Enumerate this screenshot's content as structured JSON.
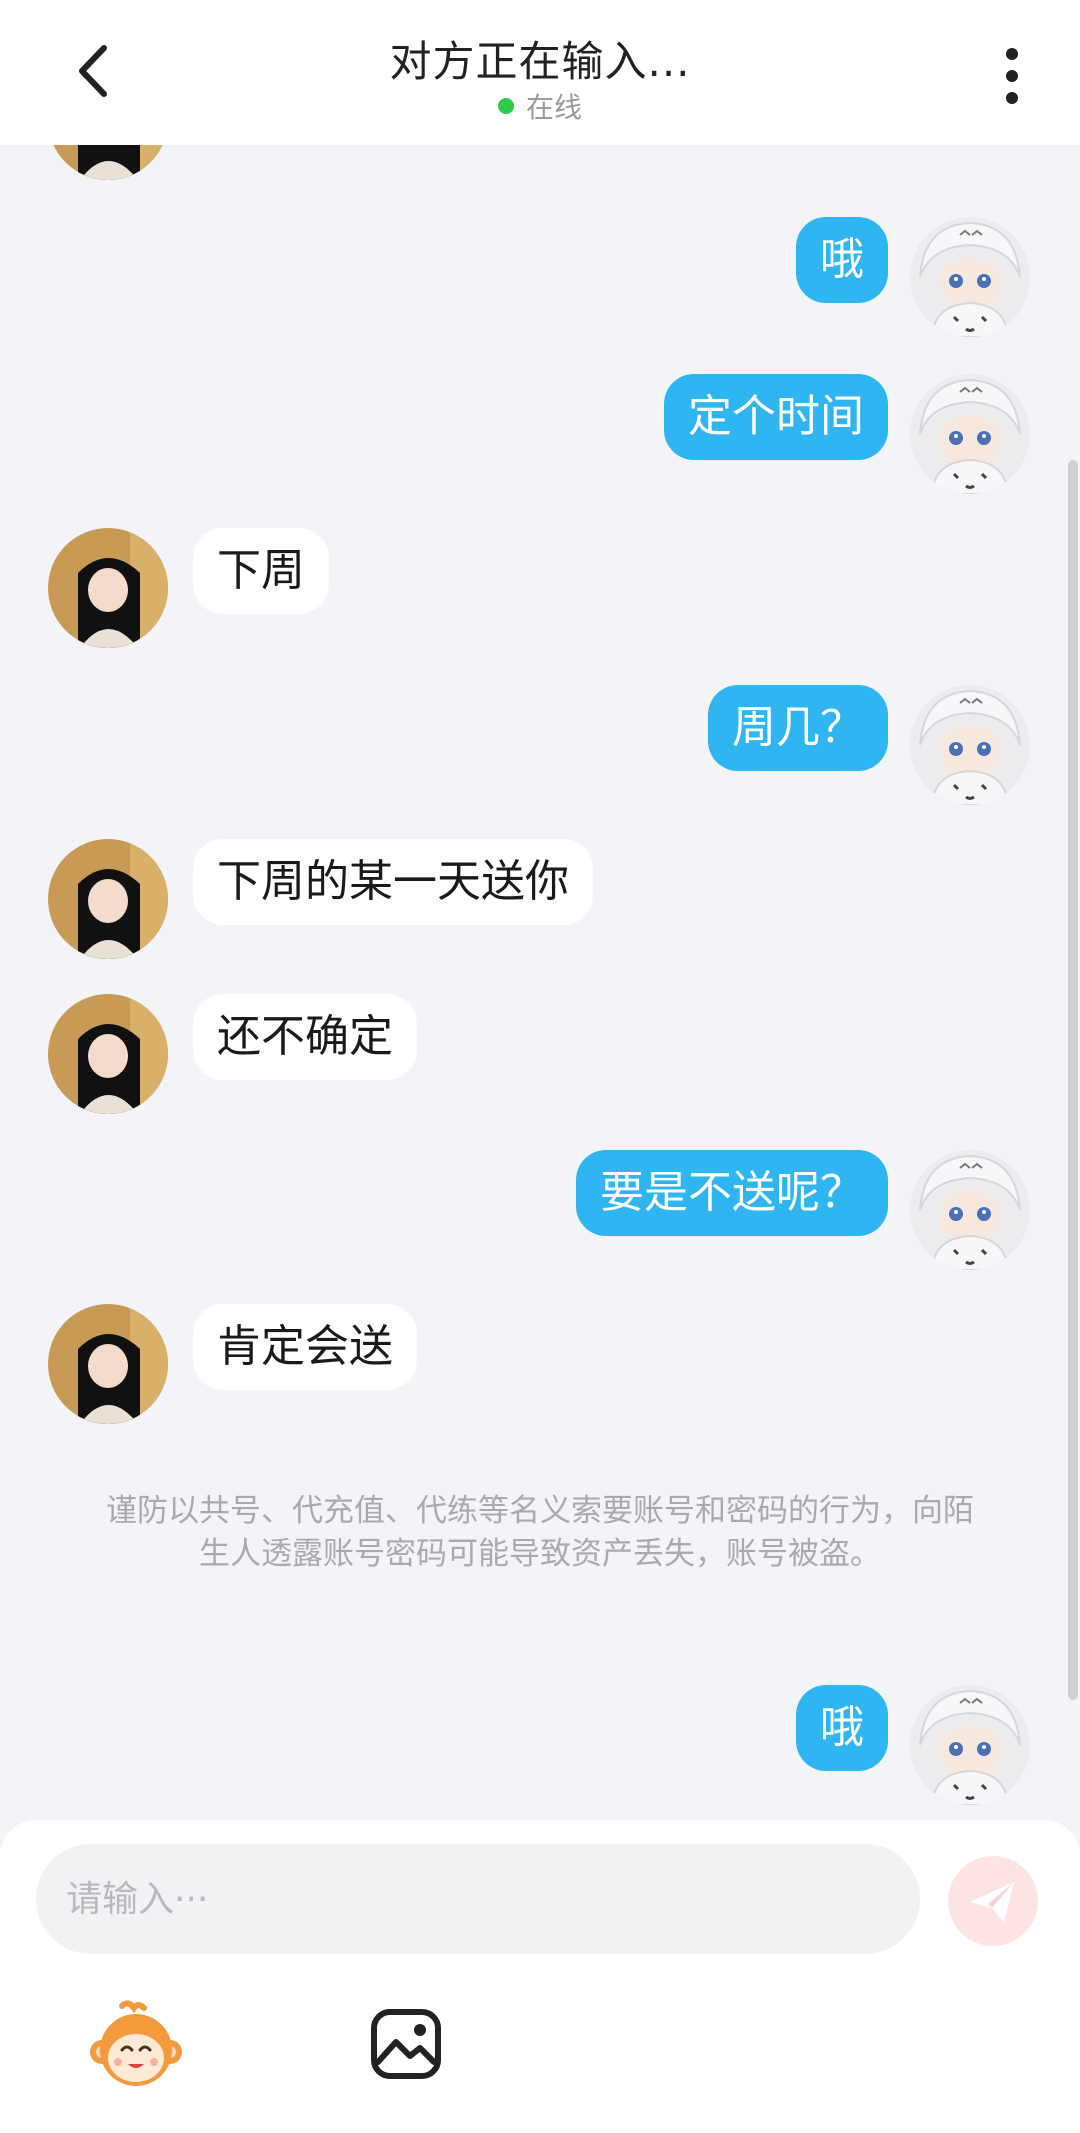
{
  "header": {
    "title": "对方正在输入...",
    "status_text": "在线",
    "status_color": "#2ec946",
    "back_icon": "chevron-left-icon",
    "more_icon": "more-vertical-icon"
  },
  "messages": [
    {
      "direction": "out",
      "text": "哦"
    },
    {
      "direction": "out",
      "text": "定个时间"
    },
    {
      "direction": "in",
      "text": "下周"
    },
    {
      "direction": "out",
      "text": "周几？"
    },
    {
      "direction": "in",
      "text": "下周的某一天送你"
    },
    {
      "direction": "in",
      "text": "还不确定"
    },
    {
      "direction": "out",
      "text": "要是不送呢？"
    },
    {
      "direction": "in",
      "text": "肯定会送"
    },
    {
      "direction": "out",
      "text": "哦"
    }
  ],
  "notice": "谨防以共号、代充值、代练等名义索要账号和密码的行为，向陌生人透露账号密码可能导致资产丢失，账号被盗。",
  "composer": {
    "placeholder": "请输入···",
    "send_icon": "paper-plane-icon",
    "emoji_icon": "monkey-emoji-icon",
    "image_icon": "image-icon"
  },
  "colors": {
    "outgoing_bubble": "#2eb5f2",
    "incoming_bubble": "#ffffff",
    "background": "#f3f4f8"
  }
}
